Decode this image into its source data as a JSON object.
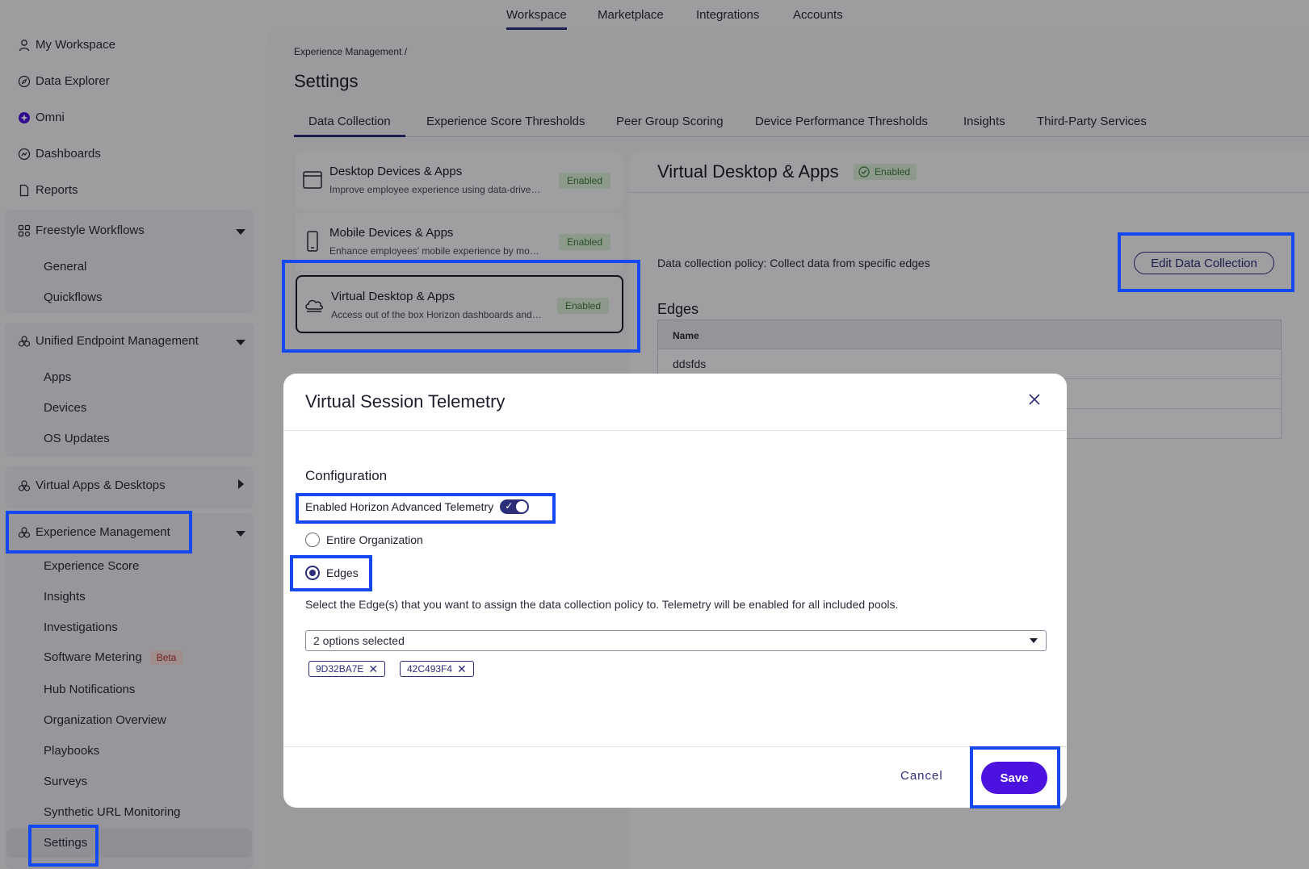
{
  "top_nav": {
    "tabs": [
      "Workspace",
      "Marketplace",
      "Integrations",
      "Accounts"
    ]
  },
  "sidebar": {
    "top_items": [
      {
        "label": "My Workspace",
        "icon": "user-icon"
      },
      {
        "label": "Data Explorer",
        "icon": "compass-icon"
      },
      {
        "label": "Omni",
        "icon": "omni-icon"
      },
      {
        "label": "Dashboards",
        "icon": "dashboard-icon"
      },
      {
        "label": "Reports",
        "icon": "document-icon"
      }
    ],
    "freestyle": {
      "label": "Freestyle Workflows",
      "items": [
        "General",
        "Quickflows"
      ]
    },
    "uem": {
      "label": "Unified Endpoint Management",
      "items": [
        "Apps",
        "Devices",
        "OS Updates"
      ]
    },
    "vad": {
      "label": "Virtual Apps & Desktops"
    },
    "xm": {
      "label": "Experience Management",
      "items": [
        "Experience Score",
        "Insights",
        "Investigations",
        "Software Metering",
        "Hub Notifications",
        "Organization Overview",
        "Playbooks",
        "Surveys",
        "Synthetic URL Monitoring",
        "Settings"
      ],
      "beta": "Beta"
    }
  },
  "page": {
    "breadcrumb": "Experience Management  /",
    "title": "Settings",
    "tabs": [
      "Data Collection",
      "Experience Score Thresholds",
      "Peer Group Scoring",
      "Device Performance Thresholds",
      "Insights",
      "Third-Party Services"
    ]
  },
  "cards": [
    {
      "title": "Desktop Devices & Apps",
      "desc": "Improve employee experience using data-driven insights",
      "badge": "Enabled"
    },
    {
      "title": "Mobile Devices & Apps",
      "desc": "Enhance employees' mobile experience by monitoring",
      "badge": "Enabled"
    },
    {
      "title": "Virtual Desktop & Apps",
      "desc": "Access out of the box Horizon dashboards and insights",
      "badge": "Enabled"
    }
  ],
  "detail": {
    "title": "Virtual Desktop & Apps",
    "status": "Enabled",
    "policy": "Data collection policy: Collect data from specific edges",
    "edit_label": "Edit Data Collection",
    "edges_heading": "Edges",
    "table_header": "Name",
    "rows": [
      "ddsfds",
      "",
      ""
    ]
  },
  "modal": {
    "title": "Virtual Session Telemetry",
    "config_heading": "Configuration",
    "toggle_label": "Enabled Horizon Advanced Telemetry",
    "toggle_on": true,
    "radio_entire": "Entire Organization",
    "radio_edges": "Edges",
    "hint": "Select the Edge(s) that you want to assign the data collection policy to. Telemetry will be enabled for all included pools.",
    "select_value": "2 options selected",
    "chips": [
      "9D32BA7E",
      "42C493F4"
    ],
    "cancel_label": "Cancel",
    "save_label": "Save"
  },
  "colors": {
    "accent": "#2b2f7a",
    "save": "#4b12e0",
    "highlight": "#1448f0",
    "enabled_bg": "#d7ecd6"
  }
}
